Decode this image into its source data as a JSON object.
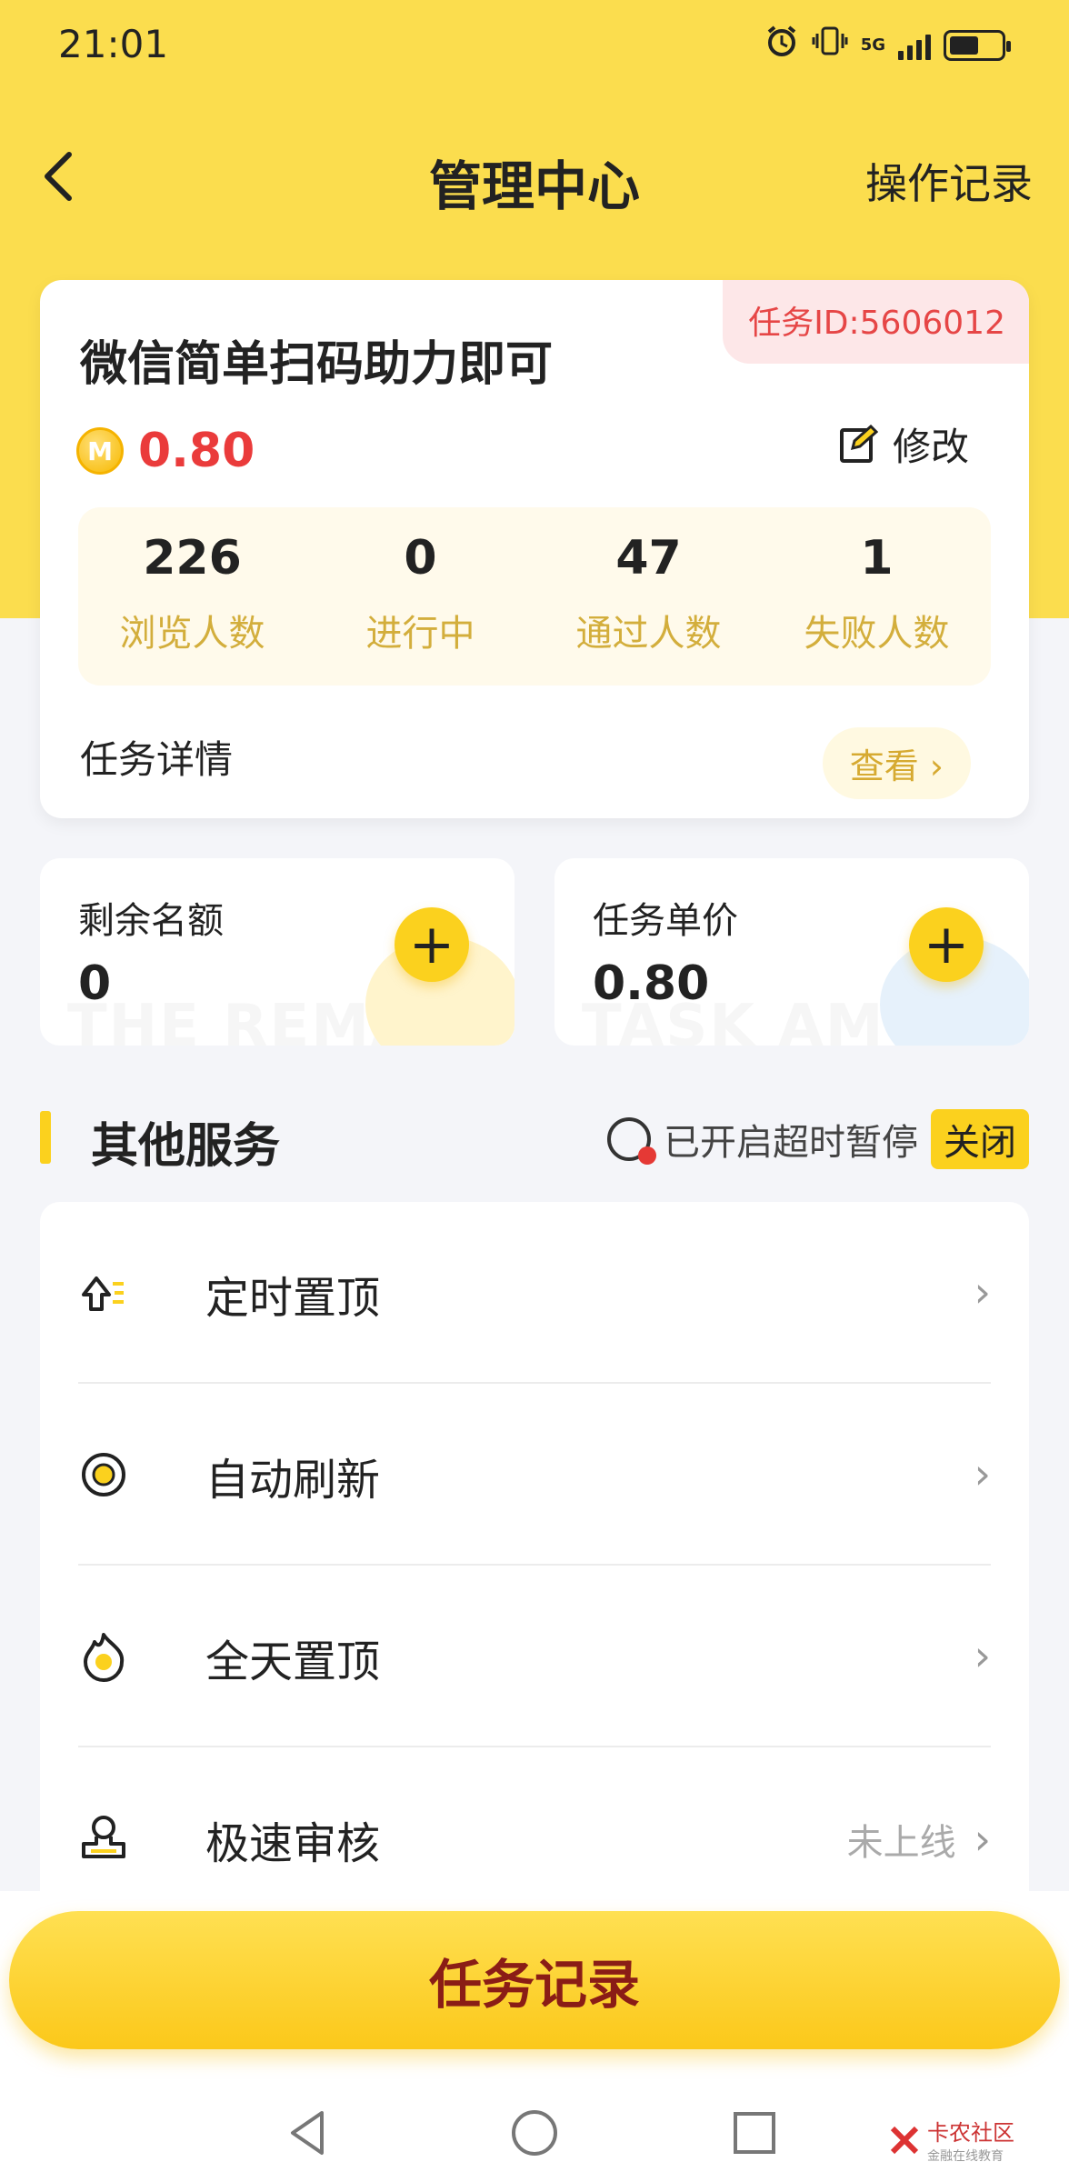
{
  "status_bar": {
    "time": "21:01",
    "network": "5G",
    "icons": [
      "alarm-icon",
      "vibrate-icon",
      "signal-icon",
      "battery-icon"
    ],
    "battery_level": 0.5
  },
  "header": {
    "title": "管理中心",
    "right_action": "操作记录"
  },
  "task_card": {
    "task_id": "任务ID:5606012",
    "title": "微信简单扫码助力即可",
    "coin_glyph": "M",
    "price": "0.80",
    "edit_label": "修改",
    "stats": [
      {
        "value": "226",
        "label": "浏览人数"
      },
      {
        "value": "0",
        "label": "进行中"
      },
      {
        "value": "47",
        "label": "通过人数"
      },
      {
        "value": "1",
        "label": "失败人数"
      }
    ],
    "detail_label": "任务详情",
    "view_label": "查看 ›"
  },
  "quota_cards": [
    {
      "title": "剩余名额",
      "value": "0",
      "watermark": "THE REMAIN"
    },
    {
      "title": "任务单价",
      "value": "0.80",
      "watermark": "TASK AMOU"
    }
  ],
  "other_services": {
    "heading": "其他服务",
    "timeout_status": "已开启超时暂停",
    "toggle_label": "关闭",
    "items": [
      {
        "label": "定时置顶",
        "icon": "scheduled-top-icon",
        "status": ""
      },
      {
        "label": "自动刷新",
        "icon": "auto-refresh-icon",
        "status": ""
      },
      {
        "label": "全天置顶",
        "icon": "all-day-top-icon",
        "status": ""
      },
      {
        "label": "极速审核",
        "icon": "fast-review-icon",
        "status": "未上线"
      }
    ]
  },
  "bottom": {
    "cta_label": "任务记录",
    "watermark_text": "卡农社区",
    "watermark_sub": "金融在线教育"
  },
  "colors": {
    "brand_yellow": "#fbdd4e",
    "price_red": "#ea3b3b",
    "stat_label": "#d3ae3c",
    "cta_text": "#8a1d16"
  }
}
